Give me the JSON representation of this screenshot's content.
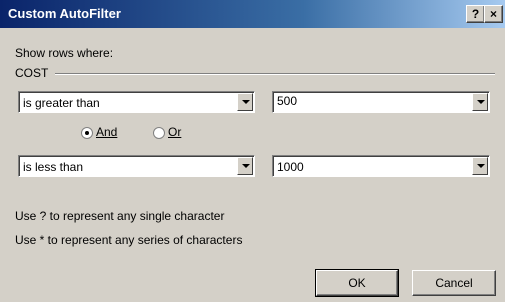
{
  "window": {
    "title": "Custom AutoFilter",
    "help_label": "?",
    "close_label": "×"
  },
  "dialog": {
    "show_rows_label": "Show rows where:",
    "field_name": "COST",
    "condition1": {
      "operator": "is greater than",
      "value": "500"
    },
    "logic": {
      "and_label": "And",
      "or_label": "Or",
      "selected": "And"
    },
    "condition2": {
      "operator": "is less than",
      "value": "1000"
    },
    "hint1": "Use ? to represent any single character",
    "hint2": "Use * to represent any series of characters",
    "ok_label": "OK",
    "cancel_label": "Cancel"
  }
}
